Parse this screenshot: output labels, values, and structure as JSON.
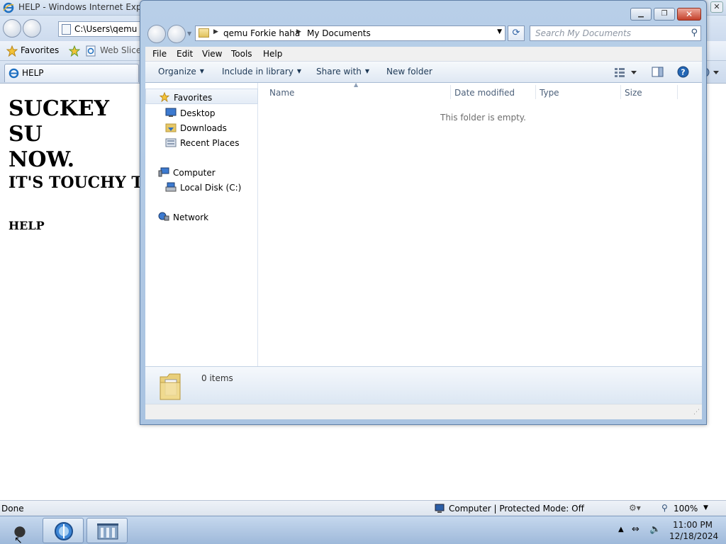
{
  "ie": {
    "window_title": "HELP - Windows Internet Explorer",
    "address": "C:\\Users\\qemu Fo",
    "favorites_label": "Favorites",
    "web_slice_label": "Web Slice Gallery",
    "tab_label": "HELP",
    "content": {
      "heading1": "SUCKEY SU\nNOW.",
      "heading2": "IT'S TOUCHY TO",
      "heading3": "HELP"
    },
    "status": {
      "left": "Done",
      "zone": "Computer | Protected Mode: Off",
      "zoom": "100%"
    }
  },
  "explorer": {
    "breadcrumb": [
      "qemu Forkie haha",
      "My Documents"
    ],
    "search_placeholder": "Search My Documents",
    "menu": [
      "File",
      "Edit",
      "View",
      "Tools",
      "Help"
    ],
    "commands": {
      "organize": "Organize",
      "include": "Include in library",
      "share": "Share with",
      "new_folder": "New folder"
    },
    "nav": {
      "favorites": "Favorites",
      "desktop": "Desktop",
      "downloads": "Downloads",
      "recent": "Recent Places",
      "computer": "Computer",
      "local_disk": "Local Disk (C:)",
      "network": "Network"
    },
    "columns": {
      "name": "Name",
      "date": "Date modified",
      "type": "Type",
      "size": "Size"
    },
    "empty_message": "This folder is empty.",
    "item_count": "0 items"
  },
  "taskbar": {
    "time": "11:00 PM",
    "date": "12/18/2024"
  },
  "colors": {
    "close_red": "#c4402b",
    "taskbar_blue": "#9eb9da",
    "folder_yellow": "#e1c25c",
    "ie_blue": "#1d6fc1"
  },
  "icons": [
    "ie-logo-icon",
    "favorites-star-icon",
    "folder-icon",
    "desktop-icon",
    "downloads-icon",
    "recent-places-icon",
    "computer-icon",
    "disk-icon",
    "network-icon",
    "search-icon",
    "refresh-icon",
    "help-icon",
    "views-icon",
    "preview-pane-icon",
    "start-orb-icon",
    "globe-icon",
    "explorer-icon",
    "volume-muted-icon",
    "network-tray-icon"
  ]
}
